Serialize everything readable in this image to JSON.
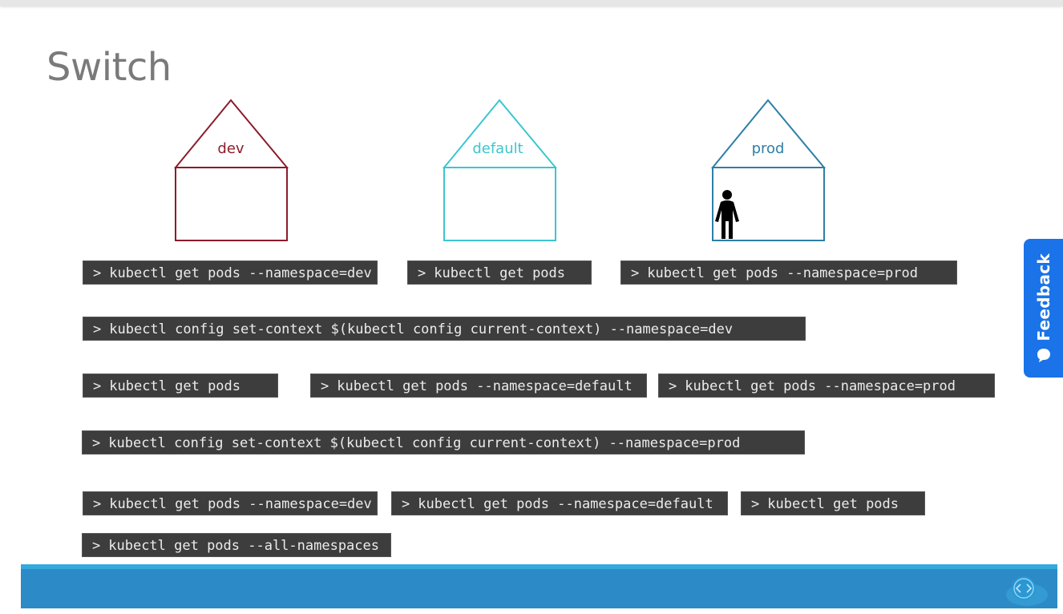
{
  "slide": {
    "title": "Switch"
  },
  "houses": [
    {
      "name": "dev",
      "color": "#8b1c2b",
      "has_person": false
    },
    {
      "name": "default",
      "color": "#3cc6cf",
      "has_person": false
    },
    {
      "name": "prod",
      "color": "#2e7fa6",
      "has_person": true
    }
  ],
  "commands": {
    "prompt": ">",
    "row1": [
      "kubectl get pods --namespace=dev",
      "kubectl get pods",
      "kubectl get pods --namespace=prod"
    ],
    "row2": "kubectl config set-context $(kubectl config current-context) --namespace=dev",
    "row3": [
      "kubectl get pods",
      "kubectl get pods --namespace=default",
      "kubectl get pods --namespace=prod"
    ],
    "row4": "kubectl config set-context $(kubectl config current-context) --namespace=prod",
    "row5": [
      "kubectl get pods --namespace=dev",
      "kubectl get pods --namespace=default",
      "kubectl get pods"
    ],
    "row6": "kubectl get pods --all-namespaces"
  },
  "feedback": {
    "label": "Feedback",
    "icon": "speech-bubble-icon"
  },
  "footer": {
    "color": "#2c8ac6",
    "logo_icon": "cloud-code-logo-icon"
  }
}
